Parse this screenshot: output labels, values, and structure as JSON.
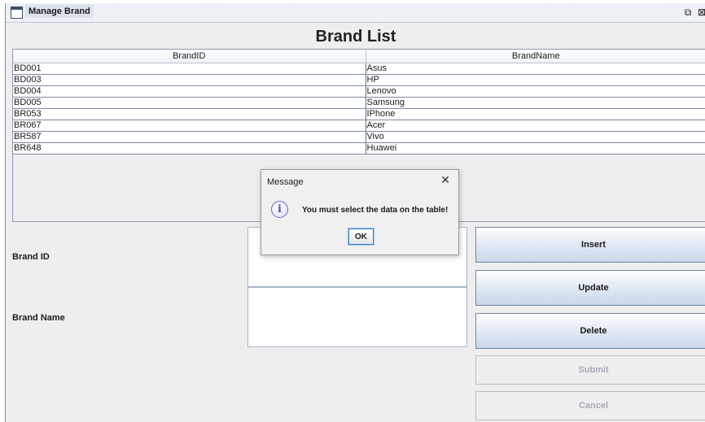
{
  "window": {
    "title": "Manage Brand",
    "controls": {
      "maximize_icon": "maximize-icon",
      "close_icon": "close-icon"
    }
  },
  "heading": "Brand List",
  "table": {
    "columns": [
      "BrandID",
      "BrandName"
    ],
    "rows": [
      [
        "BD001",
        "Asus"
      ],
      [
        "BD003",
        "HP"
      ],
      [
        "BD004",
        "Lenovo"
      ],
      [
        "BD005",
        "Samsung"
      ],
      [
        "BR053",
        "IPhone"
      ],
      [
        "BR067",
        "Acer"
      ],
      [
        "BR587",
        "Vivo"
      ],
      [
        "BR648",
        "Huawei"
      ]
    ]
  },
  "form": {
    "brand_id_label": "Brand ID",
    "brand_name_label": "Brand Name",
    "brand_id_value": "",
    "brand_name_value": ""
  },
  "buttons": {
    "insert": "Insert",
    "update": "Update",
    "delete": "Delete",
    "submit": "Submit",
    "cancel": "Cancel"
  },
  "dialog": {
    "title": "Message",
    "message": "You must select the data on the table!",
    "ok": "OK",
    "icon": "information-icon"
  }
}
